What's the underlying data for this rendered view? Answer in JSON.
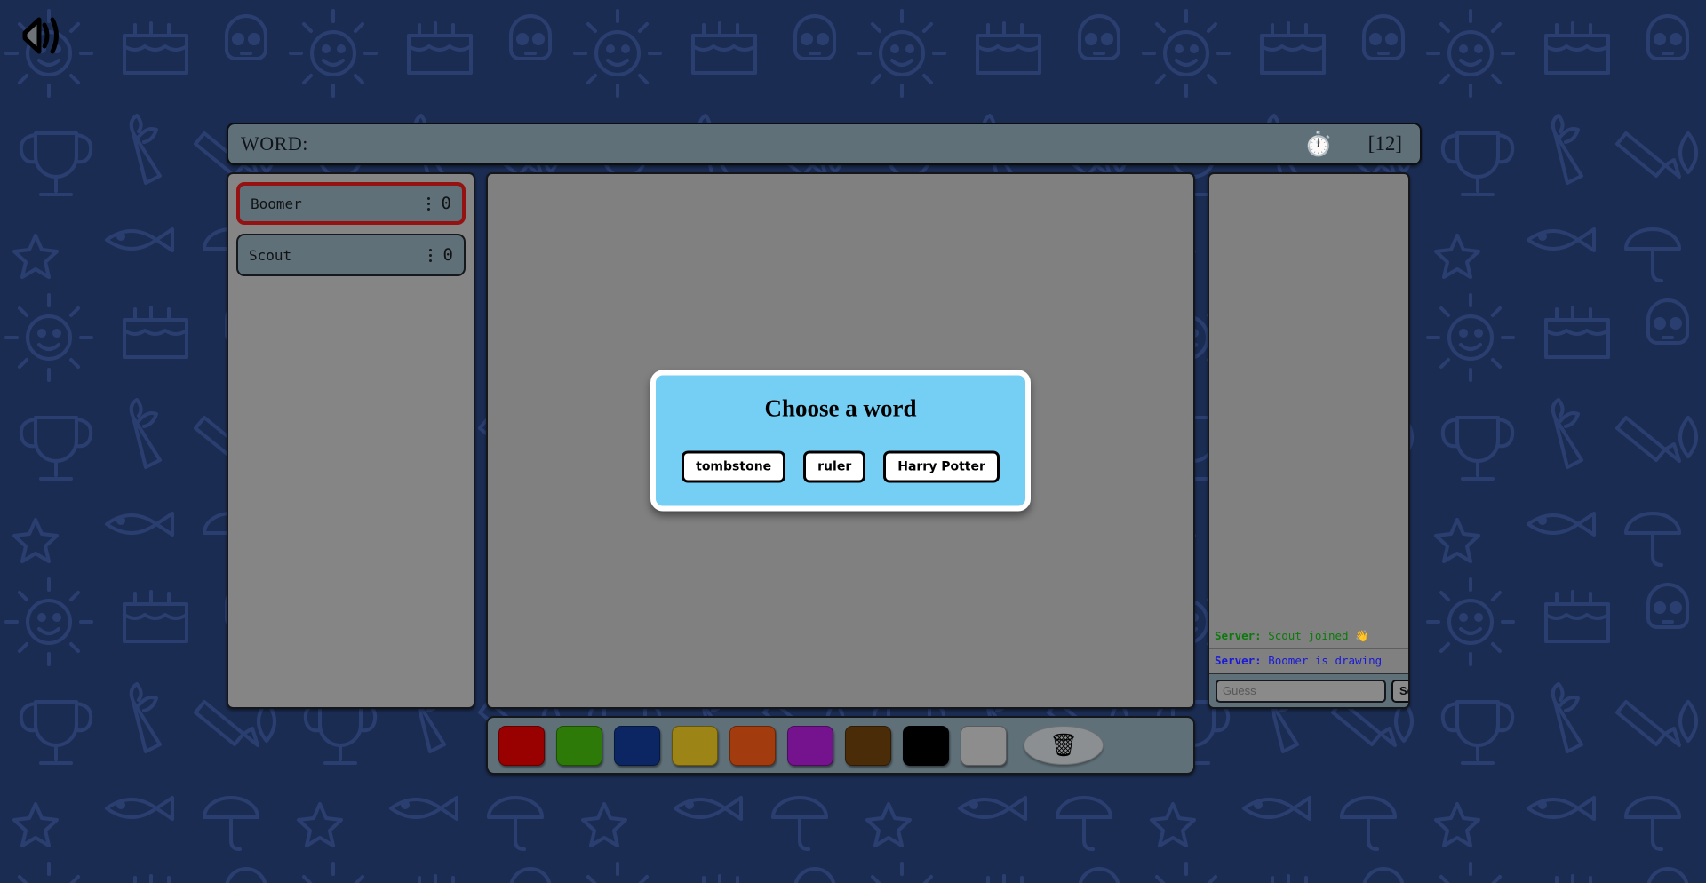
{
  "theme": {
    "background_color": "#1b2c52",
    "doodle_color": "#26396a",
    "panel_gray": "#808080",
    "slate": "#5f7078",
    "active_player_border": "#941212",
    "modal_background": "#75cff4"
  },
  "topbar": {
    "sound_icon": "speaker-icon"
  },
  "header": {
    "word_label": "WORD:",
    "word_hint": "",
    "timer_icon": "⏱️",
    "round_counter": "[12]"
  },
  "players": [
    {
      "name": "Boomer",
      "score": "0",
      "menu_icon": "vertical-dots-icon",
      "is_drawing": true
    },
    {
      "name": "Scout",
      "score": "0",
      "menu_icon": "vertical-dots-icon",
      "is_drawing": false
    }
  ],
  "modal": {
    "title": "Choose a word",
    "options": [
      "tombstone",
      "ruler",
      "Harry Potter"
    ]
  },
  "toolbar": {
    "colors": [
      {
        "name": "dark-red",
        "hex": "#990000"
      },
      {
        "name": "green",
        "hex": "#2d7a09"
      },
      {
        "name": "navy-blue",
        "hex": "#0b2663"
      },
      {
        "name": "olive-gold",
        "hex": "#9c8417"
      },
      {
        "name": "burnt-orange",
        "hex": "#a23c0f"
      },
      {
        "name": "purple",
        "hex": "#75138f"
      },
      {
        "name": "dark-brown",
        "hex": "#4a2c08"
      },
      {
        "name": "black",
        "hex": "#000000"
      },
      {
        "name": "white-gray",
        "hex": "#8d8d8d"
      }
    ],
    "clear_icon": "🗑",
    "clear_label": "clear-canvas"
  },
  "chat": {
    "messages": [
      {
        "author": "Server:",
        "text": " Scout joined 👋",
        "color": "#0b7a0b"
      },
      {
        "author": "Server:",
        "text": " Boomer is drawing",
        "color": "#1a1ad6"
      }
    ],
    "input_placeholder": "Guess",
    "input_value": "",
    "send_label": "Send"
  }
}
